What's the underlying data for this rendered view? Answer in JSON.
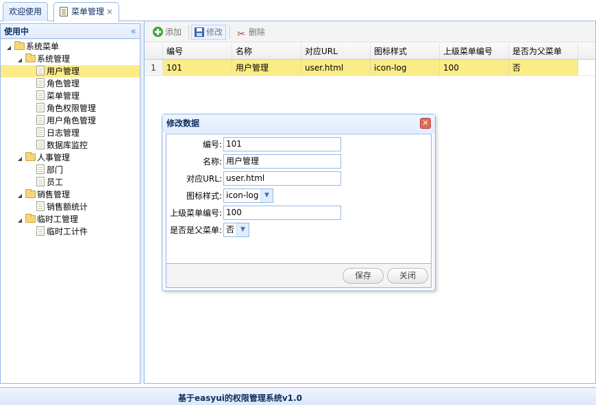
{
  "tabs": [
    {
      "label": "欢迎使用",
      "active": false
    },
    {
      "label": "菜单管理",
      "active": true,
      "closable": true
    }
  ],
  "tab_close_glyph": "×",
  "west_panel": {
    "title": "使用中",
    "collapse_glyph": "«",
    "tree": [
      {
        "label": "系统菜单",
        "level": 0,
        "type": "folder",
        "expanded": true
      },
      {
        "label": "系统管理",
        "level": 1,
        "type": "folder",
        "expanded": true
      },
      {
        "label": "用户管理",
        "level": 2,
        "type": "file",
        "selected": true
      },
      {
        "label": "角色管理",
        "level": 2,
        "type": "file"
      },
      {
        "label": "菜单管理",
        "level": 2,
        "type": "file"
      },
      {
        "label": "角色权限管理",
        "level": 2,
        "type": "file"
      },
      {
        "label": "用户角色管理",
        "level": 2,
        "type": "file"
      },
      {
        "label": "日志管理",
        "level": 2,
        "type": "file"
      },
      {
        "label": "数据库监控",
        "level": 2,
        "type": "file"
      },
      {
        "label": "人事管理",
        "level": 1,
        "type": "folder",
        "expanded": true
      },
      {
        "label": "部门",
        "level": 2,
        "type": "file"
      },
      {
        "label": "员工",
        "level": 2,
        "type": "file"
      },
      {
        "label": "销售管理",
        "level": 1,
        "type": "folder",
        "expanded": true
      },
      {
        "label": "销售额统计",
        "level": 2,
        "type": "file"
      },
      {
        "label": "临时工管理",
        "level": 1,
        "type": "folder",
        "expanded": true
      },
      {
        "label": "临时工计件",
        "level": 2,
        "type": "file"
      }
    ]
  },
  "toolbar": {
    "add_label": "添加",
    "edit_label": "修改",
    "delete_label": "删除"
  },
  "grid": {
    "columns": [
      "编号",
      "名称",
      "对应URL",
      "图标样式",
      "上级菜单编号",
      "是否为父菜单"
    ],
    "rows": [
      {
        "row_number": "1",
        "cells": [
          "101",
          "用户管理",
          "user.html",
          "icon-log",
          "100",
          "否"
        ]
      }
    ]
  },
  "dialog": {
    "title": "修改数据",
    "close_glyph": "✕",
    "fields": {
      "id_label": "编号:",
      "id_value": "101",
      "name_label": "名称:",
      "name_value": "用户管理",
      "url_label": "对应URL:",
      "url_value": "user.html",
      "icon_label": "图标样式:",
      "icon_value": "icon-log",
      "parent_label": "上级菜单编号:",
      "parent_value": "100",
      "is_parent_label": "是否是父菜单:",
      "is_parent_value": "否"
    },
    "save_label": "保存",
    "close_label": "关闭"
  },
  "footer": {
    "text": "基于easyui的权限管理系统v1.0"
  },
  "icons": {
    "add": "add-icon",
    "edit": "save-icon",
    "delete": "scissors-icon",
    "folder": "folder-icon",
    "file": "file-icon"
  },
  "colors": {
    "border": "#95b8e7",
    "header_bg": "#e0ecff",
    "selected_bg": "#fbec88",
    "title_text": "#0e2d5f"
  }
}
